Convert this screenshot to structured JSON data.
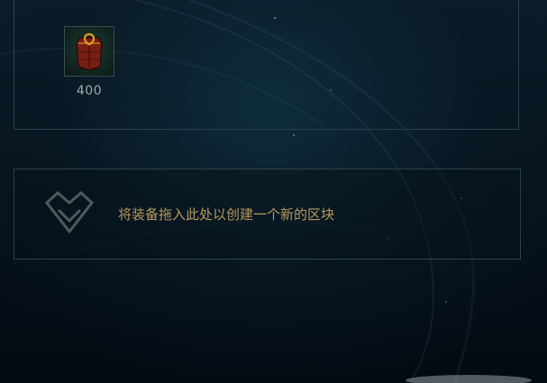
{
  "item_set": {
    "items": [
      {
        "icon": "chest-armor-icon",
        "cost": "400"
      }
    ]
  },
  "new_block_dropzone": {
    "icon": "drop-zone-icon",
    "text": "将装备拖入此处以创建一个新的区块"
  },
  "colors": {
    "panel_border": "#27414a",
    "dropzone_text": "#b89860",
    "cost_text": "#a3aaa8",
    "background": "#040a12"
  }
}
